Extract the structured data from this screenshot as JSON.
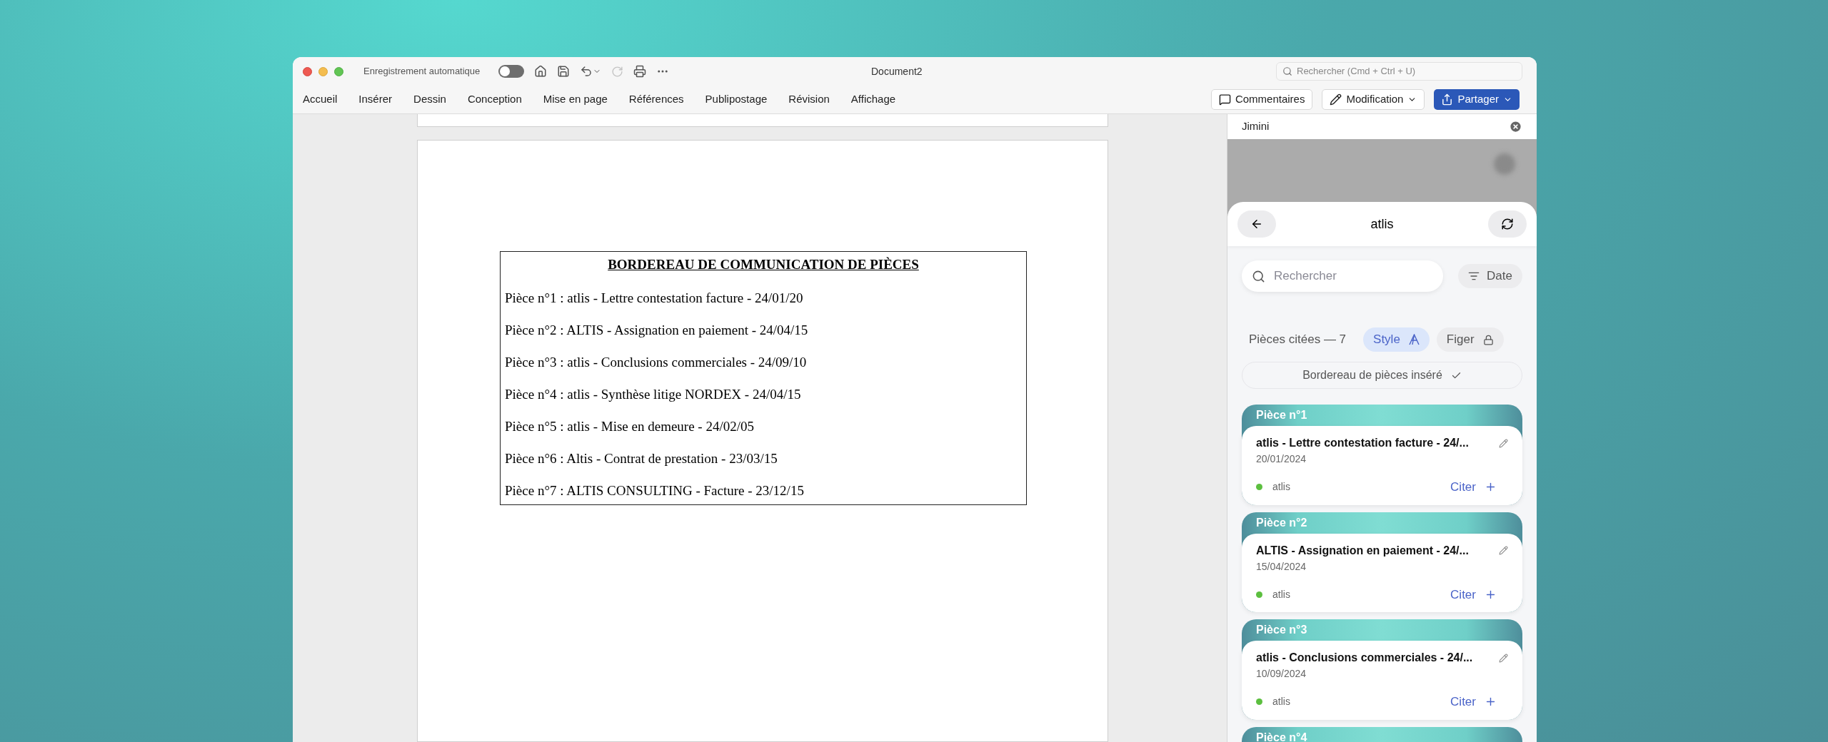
{
  "window": {
    "title": "Document2",
    "autosave": {
      "label": "Enregistrement automatique",
      "on": false
    },
    "search": {
      "placeholder": "Rechercher (Cmd + Ctrl + U)"
    }
  },
  "ribbon": {
    "tabs": [
      "Accueil",
      "Insérer",
      "Dessin",
      "Conception",
      "Mise en page",
      "Références",
      "Publipostage",
      "Révision",
      "Affichage"
    ],
    "buttons": [
      {
        "kind": "comments",
        "label": "Commentaires"
      },
      {
        "kind": "mode",
        "label": "Modification"
      },
      {
        "kind": "share",
        "label": "Partager"
      }
    ]
  },
  "document": {
    "heading": "BORDEREAU DE COMMUNICATION DE PIÈCES",
    "lines": [
      "Pièce n°1 : atlis - Lettre contestation facture - 24/01/20",
      "Pièce n°2 : ALTIS - Assignation en paiement - 24/04/15",
      "Pièce n°3 : atlis - Conclusions commerciales - 24/09/10",
      "Pièce n°4 : atlis - Synthèse litige NORDEX - 24/04/15",
      "Pièce n°5 : atlis - Mise en demeure - 24/02/05",
      "Pièce n°6 : Altis - Contrat de prestation - 23/03/15",
      "Pièce n°7 : ALTIS CONSULTING - Facture - 23/12/15"
    ]
  },
  "panel": {
    "title": "Jimini",
    "header_title": "atlis",
    "search": {
      "placeholder": "Rechercher"
    },
    "filter": "Date",
    "cited_label": "Pièces citées — 7",
    "style_button": {
      "label": "Style",
      "selected": true
    },
    "lock_button": {
      "label": "Figer",
      "selected": false
    },
    "inserted_banner": "Bordereau de pièces inséré",
    "pieces": [
      {
        "label": "Pièce n°1",
        "title": "atlis - Lettre contestation facture - 24/...",
        "date": "20/01/2024",
        "source": "atlis",
        "color": "#5cbf3f",
        "action": "Citer"
      },
      {
        "label": "Pièce n°2",
        "title": "ALTIS - Assignation en paiement - 24/...",
        "date": "15/04/2024",
        "source": "atlis",
        "color": "#5cbf3f",
        "action": "Citer"
      },
      {
        "label": "Pièce n°3",
        "title": "atlis - Conclusions commerciales - 24/...",
        "date": "10/09/2024",
        "source": "atlis",
        "color": "#5cbf3f",
        "action": "Citer"
      },
      {
        "label": "Pièce n°4"
      }
    ]
  }
}
